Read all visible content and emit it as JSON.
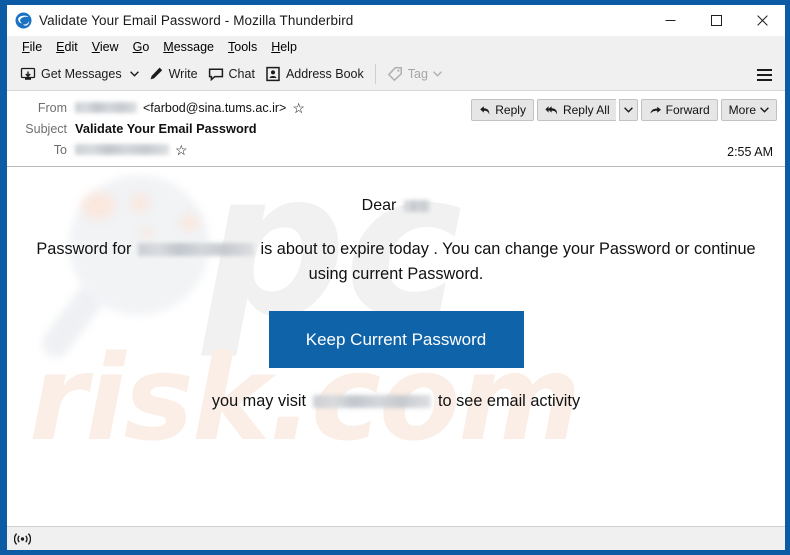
{
  "window": {
    "title": "Validate Your Email Password - Mozilla Thunderbird",
    "app_icon": "thunderbird-icon",
    "controls": {
      "minimize": "minimize-icon",
      "maximize": "maximize-icon",
      "close": "close-icon"
    },
    "border_color": "#0b5ca5"
  },
  "menubar": {
    "items": [
      {
        "label": "File",
        "accel": "F"
      },
      {
        "label": "Edit",
        "accel": "E"
      },
      {
        "label": "View",
        "accel": "V"
      },
      {
        "label": "Go",
        "accel": "G"
      },
      {
        "label": "Message",
        "accel": "M"
      },
      {
        "label": "Tools",
        "accel": "T"
      },
      {
        "label": "Help",
        "accel": "H"
      }
    ]
  },
  "toolbar": {
    "get_messages_label": "Get Messages",
    "write_label": "Write",
    "chat_label": "Chat",
    "address_book_label": "Address Book",
    "tag_label": "Tag",
    "tag_disabled": true,
    "app_menu_icon": "hamburger-icon"
  },
  "message_header": {
    "from_label": "From",
    "from_name_redacted": "",
    "from_address": "<farbod@sina.tums.ac.ir>",
    "subject_label": "Subject",
    "subject": "Validate Your Email Password",
    "to_label": "To",
    "to_redacted": "",
    "timestamp": "2:55 AM",
    "actions": {
      "reply": "Reply",
      "reply_all": "Reply All",
      "forward": "Forward",
      "more": "More"
    }
  },
  "message_body": {
    "greeting_prefix": "Dear",
    "greeting_name_redacted": "",
    "paragraph_prefix": "Password for",
    "paragraph_email_redacted": "",
    "paragraph_suffix": "is about to expire today . You can change your Password or continue using current Password.",
    "cta_label": "Keep Current Password",
    "cta_color": "#0f63a8",
    "footer_prefix": "you may visit",
    "footer_link_redacted": "",
    "footer_suffix": "to see email activity",
    "watermark": {
      "big_text": "pc",
      "small_text": "risk.com",
      "glass_icon": "magnifier-watermark"
    }
  },
  "statusbar": {
    "icon": "broadcast-icon",
    "text": ""
  }
}
